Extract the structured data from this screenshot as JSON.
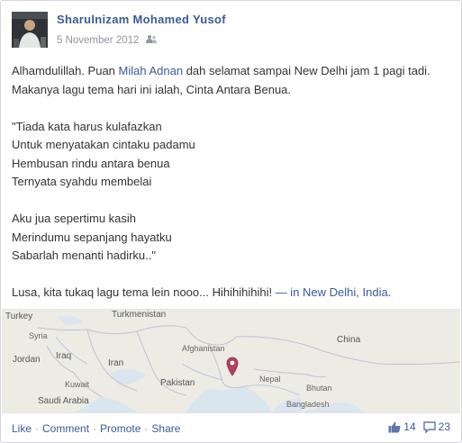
{
  "post": {
    "author": "Sharulnizam Mohamed Yusof",
    "date": "5 November 2012",
    "intro_before": "Alhamdulillah. Puan ",
    "tagged_person": "Milah Adnan",
    "intro_after": " dah selamat sampai New Delhi jam 1 pagi tadi. Makanya lagu tema hari ini ialah, Cinta Antara Benua.",
    "stanza1": [
      "\"Tiada kata harus kulafazkan",
      "Untuk menyatakan cintaku padamu",
      "Hembusan rindu antara benua",
      "Ternyata syahdu membelai"
    ],
    "stanza2": [
      "Aku jua sepertimu kasih",
      "Merindumu sepanjang hayatku",
      "Sabarlah menanti hadirku..\""
    ],
    "closing": "Lusa, kita tukaq lagu tema lein nooo... Hihihihihihi! ",
    "location_prefix": "— in ",
    "location": "New Delhi, India",
    "location_suffix": "."
  },
  "map": {
    "labels": {
      "turkey": "Turkey",
      "turkmenistan": "Turkmenistan",
      "syria": "Syria",
      "iraq": "Iraq",
      "jordan": "Jordan",
      "iran": "Iran",
      "afghanistan": "Afghanistan",
      "pakistan": "Pakistan",
      "nepal": "Nepal",
      "china": "China",
      "saudi": "Saudi Arabia",
      "kuwait": "Kuwait",
      "bangladesh": "Bangladesh",
      "bhutan": "Bhutan"
    },
    "pin_icon": "location-pin-icon"
  },
  "footer": {
    "like": "Like",
    "comment": "Comment",
    "promote": "Promote",
    "share": "Share",
    "separator": "·",
    "likes_count": "14",
    "comments_count": "23"
  }
}
